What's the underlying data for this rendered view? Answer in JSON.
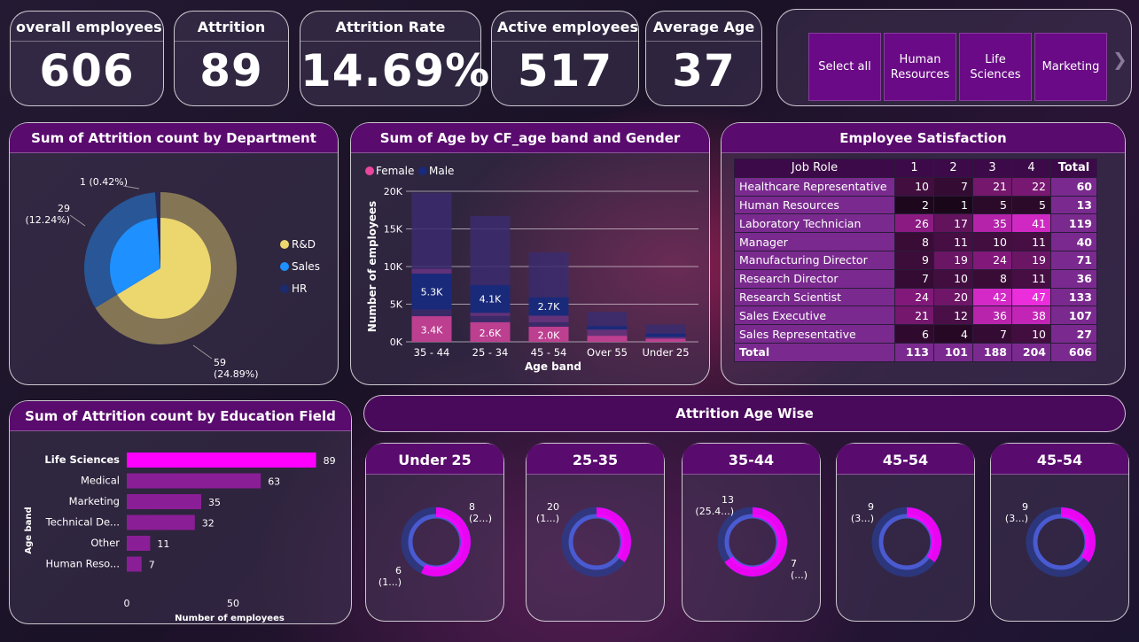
{
  "kpis": {
    "overall_employees": {
      "label": "overall employees",
      "value": "606"
    },
    "attrition": {
      "label": "Attrition",
      "value": "89"
    },
    "attrition_rate": {
      "label": "Attrition Rate",
      "value": "14.69%"
    },
    "active_employees": {
      "label": "Active employees",
      "value": "517"
    },
    "average_age": {
      "label": "Average Age",
      "value": "37"
    }
  },
  "slicer": {
    "items": [
      "Select all",
      "Human Resources",
      "Life Sciences",
      "Marketing"
    ],
    "next_icon": "chevron-right-icon"
  },
  "colors": {
    "rd": "#ecd66e",
    "sales": "#1e90ff",
    "hr": "#1c2a6e",
    "female": "#e8479d",
    "male": "#1a2a7a",
    "magenta": "#ff00ff",
    "panel_title": "#5a0b6e"
  },
  "chart_data": [
    {
      "id": "dept",
      "type": "pie",
      "title": "Sum of Attrition count by Department",
      "categories": [
        "R&D",
        "Sales",
        "HR"
      ],
      "values": [
        59,
        29,
        1
      ],
      "data_labels": [
        "59\n(24.89%)",
        "29\n(12.24%)",
        "1 (0.42%)"
      ],
      "legend_position": "right"
    },
    {
      "id": "ageband",
      "type": "bar",
      "title": "Sum of Age by CF_age band and Gender",
      "categories": [
        "35 - 44",
        "25 - 34",
        "45 - 54",
        "Over 55",
        "Under 25"
      ],
      "series": [
        {
          "name": "Female",
          "values": [
            3400,
            2600,
            2000,
            800,
            400
          ],
          "labels": [
            "3.4K",
            "2.6K",
            "2.0K",
            "",
            ""
          ]
        },
        {
          "name": "Male",
          "values": [
            5300,
            4100,
            2700,
            1300,
            700
          ],
          "labels": [
            "5.3K",
            "4.1K",
            "2.7K",
            "",
            ""
          ]
        }
      ],
      "totals": [
        19800,
        16700,
        11900,
        4000,
        2300
      ],
      "xlabel": "Age band",
      "ylabel": "Number of employees",
      "ylim": [
        0,
        20000
      ],
      "yticks": [
        "0K",
        "5K",
        "10K",
        "15K",
        "20K"
      ],
      "legend_position": "top-left",
      "grid": true
    },
    {
      "id": "satisfaction",
      "type": "table",
      "title": "Employee Satisfaction",
      "columns": [
        "Job Role",
        "1",
        "2",
        "3",
        "4",
        "Total"
      ],
      "rows": [
        [
          "Healthcare Representative",
          "10",
          "7",
          "21",
          "22",
          "60"
        ],
        [
          "Human Resources",
          "2",
          "1",
          "5",
          "5",
          "13"
        ],
        [
          "Laboratory Technician",
          "26",
          "17",
          "35",
          "41",
          "119"
        ],
        [
          "Manager",
          "8",
          "11",
          "10",
          "11",
          "40"
        ],
        [
          "Manufacturing Director",
          "9",
          "19",
          "24",
          "19",
          "71"
        ],
        [
          "Research Director",
          "7",
          "10",
          "8",
          "11",
          "36"
        ],
        [
          "Research Scientist",
          "24",
          "20",
          "42",
          "47",
          "133"
        ],
        [
          "Sales Executive",
          "21",
          "12",
          "36",
          "38",
          "107"
        ],
        [
          "Sales Representative",
          "6",
          "4",
          "7",
          "10",
          "27"
        ]
      ],
      "total_row": [
        "Total",
        "113",
        "101",
        "188",
        "204",
        "606"
      ]
    },
    {
      "id": "education",
      "type": "bar",
      "orientation": "horizontal",
      "title": "Sum of Attrition count by Education Field",
      "categories": [
        "Life Sciences",
        "Medical",
        "Marketing",
        "Technical De...",
        "Other",
        "Human Reso..."
      ],
      "values": [
        89,
        63,
        35,
        32,
        11,
        7
      ],
      "xlabel": "Number of employees",
      "ylabel": "Age band",
      "xticks": [
        "0",
        "50"
      ],
      "xlim": [
        0,
        100
      ]
    },
    {
      "id": "age_wise",
      "type": "pie",
      "title": "Attrition Age Wise",
      "panels": [
        {
          "title": "Under 25",
          "values": [
            8,
            6
          ],
          "labels": [
            "8\n(2...)",
            "6\n(1...)"
          ]
        },
        {
          "title": "25-35",
          "values": [
            20,
            0
          ],
          "labels": [
            "20\n(1...)",
            ""
          ]
        },
        {
          "title": "35-44",
          "values": [
            13,
            7
          ],
          "labels": [
            "13\n(25.4...)",
            "7\n(...)"
          ]
        },
        {
          "title": "45-54",
          "values": [
            9,
            0
          ],
          "labels": [
            "9\n(3...)",
            ""
          ]
        },
        {
          "title": "45-54",
          "values": [
            9,
            0
          ],
          "labels": [
            "9\n(3...)",
            ""
          ]
        }
      ]
    }
  ]
}
